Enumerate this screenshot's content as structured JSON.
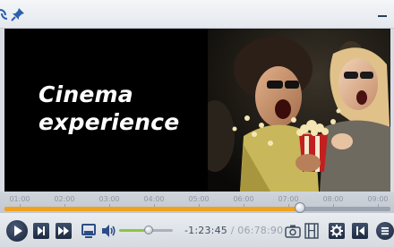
{
  "app": {
    "icons": [
      "sync-icon",
      "pin-icon",
      "minimize-icon"
    ]
  },
  "video": {
    "title_line1": "Cinema",
    "title_line2": "experience"
  },
  "timeline": {
    "ticks": [
      "01:00",
      "02:00",
      "03:00",
      "04:00",
      "05:00",
      "06:00",
      "07:00",
      "08:00",
      "09:00"
    ],
    "progress": 0.765
  },
  "controls": {
    "remaining": "-1:23:45",
    "separator": "/",
    "duration": "06:78:90",
    "volume": 0.55,
    "accent": "#f0a21f",
    "volume_color": "#8dc63f"
  }
}
